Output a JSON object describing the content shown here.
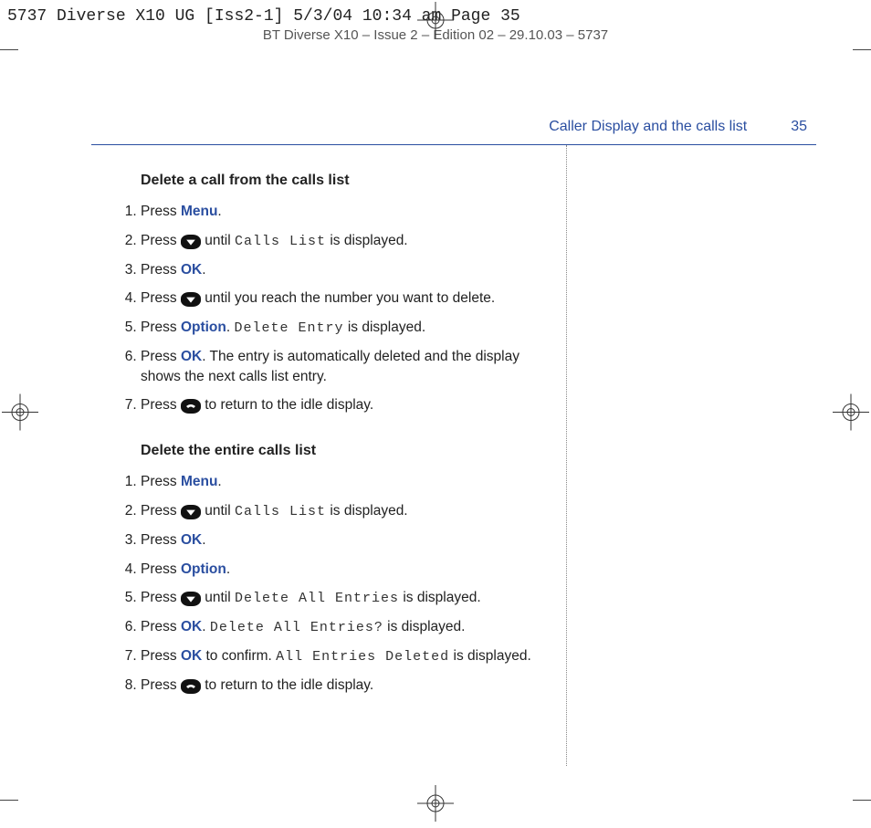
{
  "print_header": "5737 Diverse X10 UG [Iss2-1]  5/3/04  10:34 am  Page 35",
  "doc_header": "BT Diverse X10 – Issue 2 – Edition 02 – 29.10.03 – 5737",
  "section_title": "Caller Display and the calls list",
  "page_number": "35",
  "headings": {
    "h1": "Delete a call from the calls list",
    "h2": "Delete the entire calls list"
  },
  "keys": {
    "menu": "Menu",
    "ok": "OK",
    "option": "Option"
  },
  "lcd": {
    "calls_list": "Calls List",
    "delete_entry": "Delete Entry",
    "delete_all": "Delete All Entries",
    "delete_all_q": "Delete All Entries?",
    "all_deleted": "All Entries Deleted"
  },
  "txt": {
    "press": "Press ",
    "until": " until ",
    "is_displayed": " is displayed.",
    "until_reach": " until you reach the number you want to delete.",
    "dot": ". ",
    "period": ".",
    "auto_delete": ". The entry is automatically deleted and the display shows the next calls list entry.",
    "return_idle": " to return to the idle display.",
    "to_confirm": " to confirm. "
  }
}
